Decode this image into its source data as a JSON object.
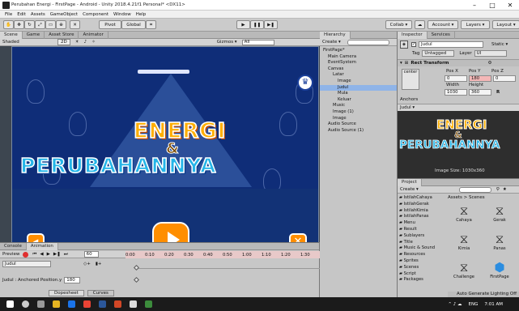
{
  "window": {
    "title": "Perubahan Energi - FirstPage - Android - Unity 2018.4.21f1 Personal* <DX11>",
    "minimize": "–",
    "maximize": "□",
    "close": "✕"
  },
  "menu": [
    "File",
    "Edit",
    "Assets",
    "GameObject",
    "Component",
    "Window",
    "Help"
  ],
  "toolbar": {
    "pivot": "Pivot",
    "global": "Global",
    "collab": "Collab ▾",
    "account": "Account ▾",
    "layers": "Layers ▾",
    "layout": "Layout ▾"
  },
  "scene_tabs": [
    "Scene",
    "Game",
    "Asset Store",
    "Animator"
  ],
  "scene_tools": {
    "shading": "Shaded",
    "mode": "2D",
    "gizmos": "Gizmos ▾",
    "search": "All"
  },
  "game": {
    "title_word1": "ENERGI",
    "title_amp": "&",
    "title_word2": "PERUBAHANNYA"
  },
  "anim": {
    "tabs": [
      "Console",
      "Animation"
    ],
    "preview": "Preview",
    "frame": "60",
    "clip": "Judul",
    "property": "Judul : Anchored Position.y",
    "property_value": "180",
    "timeline": [
      "0:00",
      "0:10",
      "0:20",
      "0:30",
      "0:40",
      "0:50",
      "1:00",
      "1:10",
      "1:20",
      "1:30"
    ],
    "bottom_tabs": [
      "Dopesheet",
      "Curves"
    ]
  },
  "hierarchy": {
    "tab": "Hierarchy",
    "create": "Create ▾",
    "items": [
      {
        "label": "FirstPage*",
        "indent": 0
      },
      {
        "label": "Main Camera",
        "indent": 1
      },
      {
        "label": "EventSystem",
        "indent": 1
      },
      {
        "label": "Canvas",
        "indent": 1
      },
      {
        "label": "Latar",
        "indent": 2
      },
      {
        "label": "Image",
        "indent": 3
      },
      {
        "label": "Judul",
        "indent": 3
      },
      {
        "label": "Mula",
        "indent": 3
      },
      {
        "label": "Keluar",
        "indent": 3
      },
      {
        "label": "Music",
        "indent": 2
      },
      {
        "label": "Image (1)",
        "indent": 2
      },
      {
        "label": "Image",
        "indent": 2
      },
      {
        "label": "Audio Source",
        "indent": 1
      },
      {
        "label": "Audio Source (1)",
        "indent": 1
      }
    ]
  },
  "inspector": {
    "tabs": [
      "Inspector",
      "Services"
    ],
    "name": "Judul",
    "static": "Static ▾",
    "tag_label": "Tag",
    "tag": "Untagged",
    "layer_label": "Layer",
    "layer": "UI",
    "component": "Rect Transform",
    "anchor": "center",
    "pos_x_label": "Pos X",
    "pos_y_label": "Pos Y",
    "pos_z_label": "Pos Z",
    "pos_x": "0",
    "pos_y": "180",
    "pos_z": "0",
    "width_label": "Width",
    "height_label": "Height",
    "width": "1030",
    "height": "360",
    "anchors": "Anchors",
    "preview_name": "Judul ▾",
    "preview_word1": "ENERGI",
    "preview_amp": "&",
    "preview_word2": "PERUBAHANNYA",
    "preview_caption": "Image Size: 1030x360"
  },
  "project": {
    "tab": "Project",
    "create": "Create ▾",
    "breadcrumb": "Assets > Scenes",
    "folders": [
      "IstilahCahaya",
      "IstilahGerak",
      "IstilahKimia",
      "IstilahPanas",
      "Menu",
      "Result",
      "Sublayers",
      "Title",
      "Music & Sound",
      "Resources",
      "Sprites",
      "Scenes",
      "Script",
      "Packages"
    ],
    "assets": [
      "Cahaya",
      "Gerak",
      "Kimia",
      "Panas",
      "Challenge",
      "FirstPage"
    ],
    "status": "Auto Generate Lighting Off"
  },
  "taskbar": {
    "lang": "ENG",
    "time": "7:01 AM"
  }
}
